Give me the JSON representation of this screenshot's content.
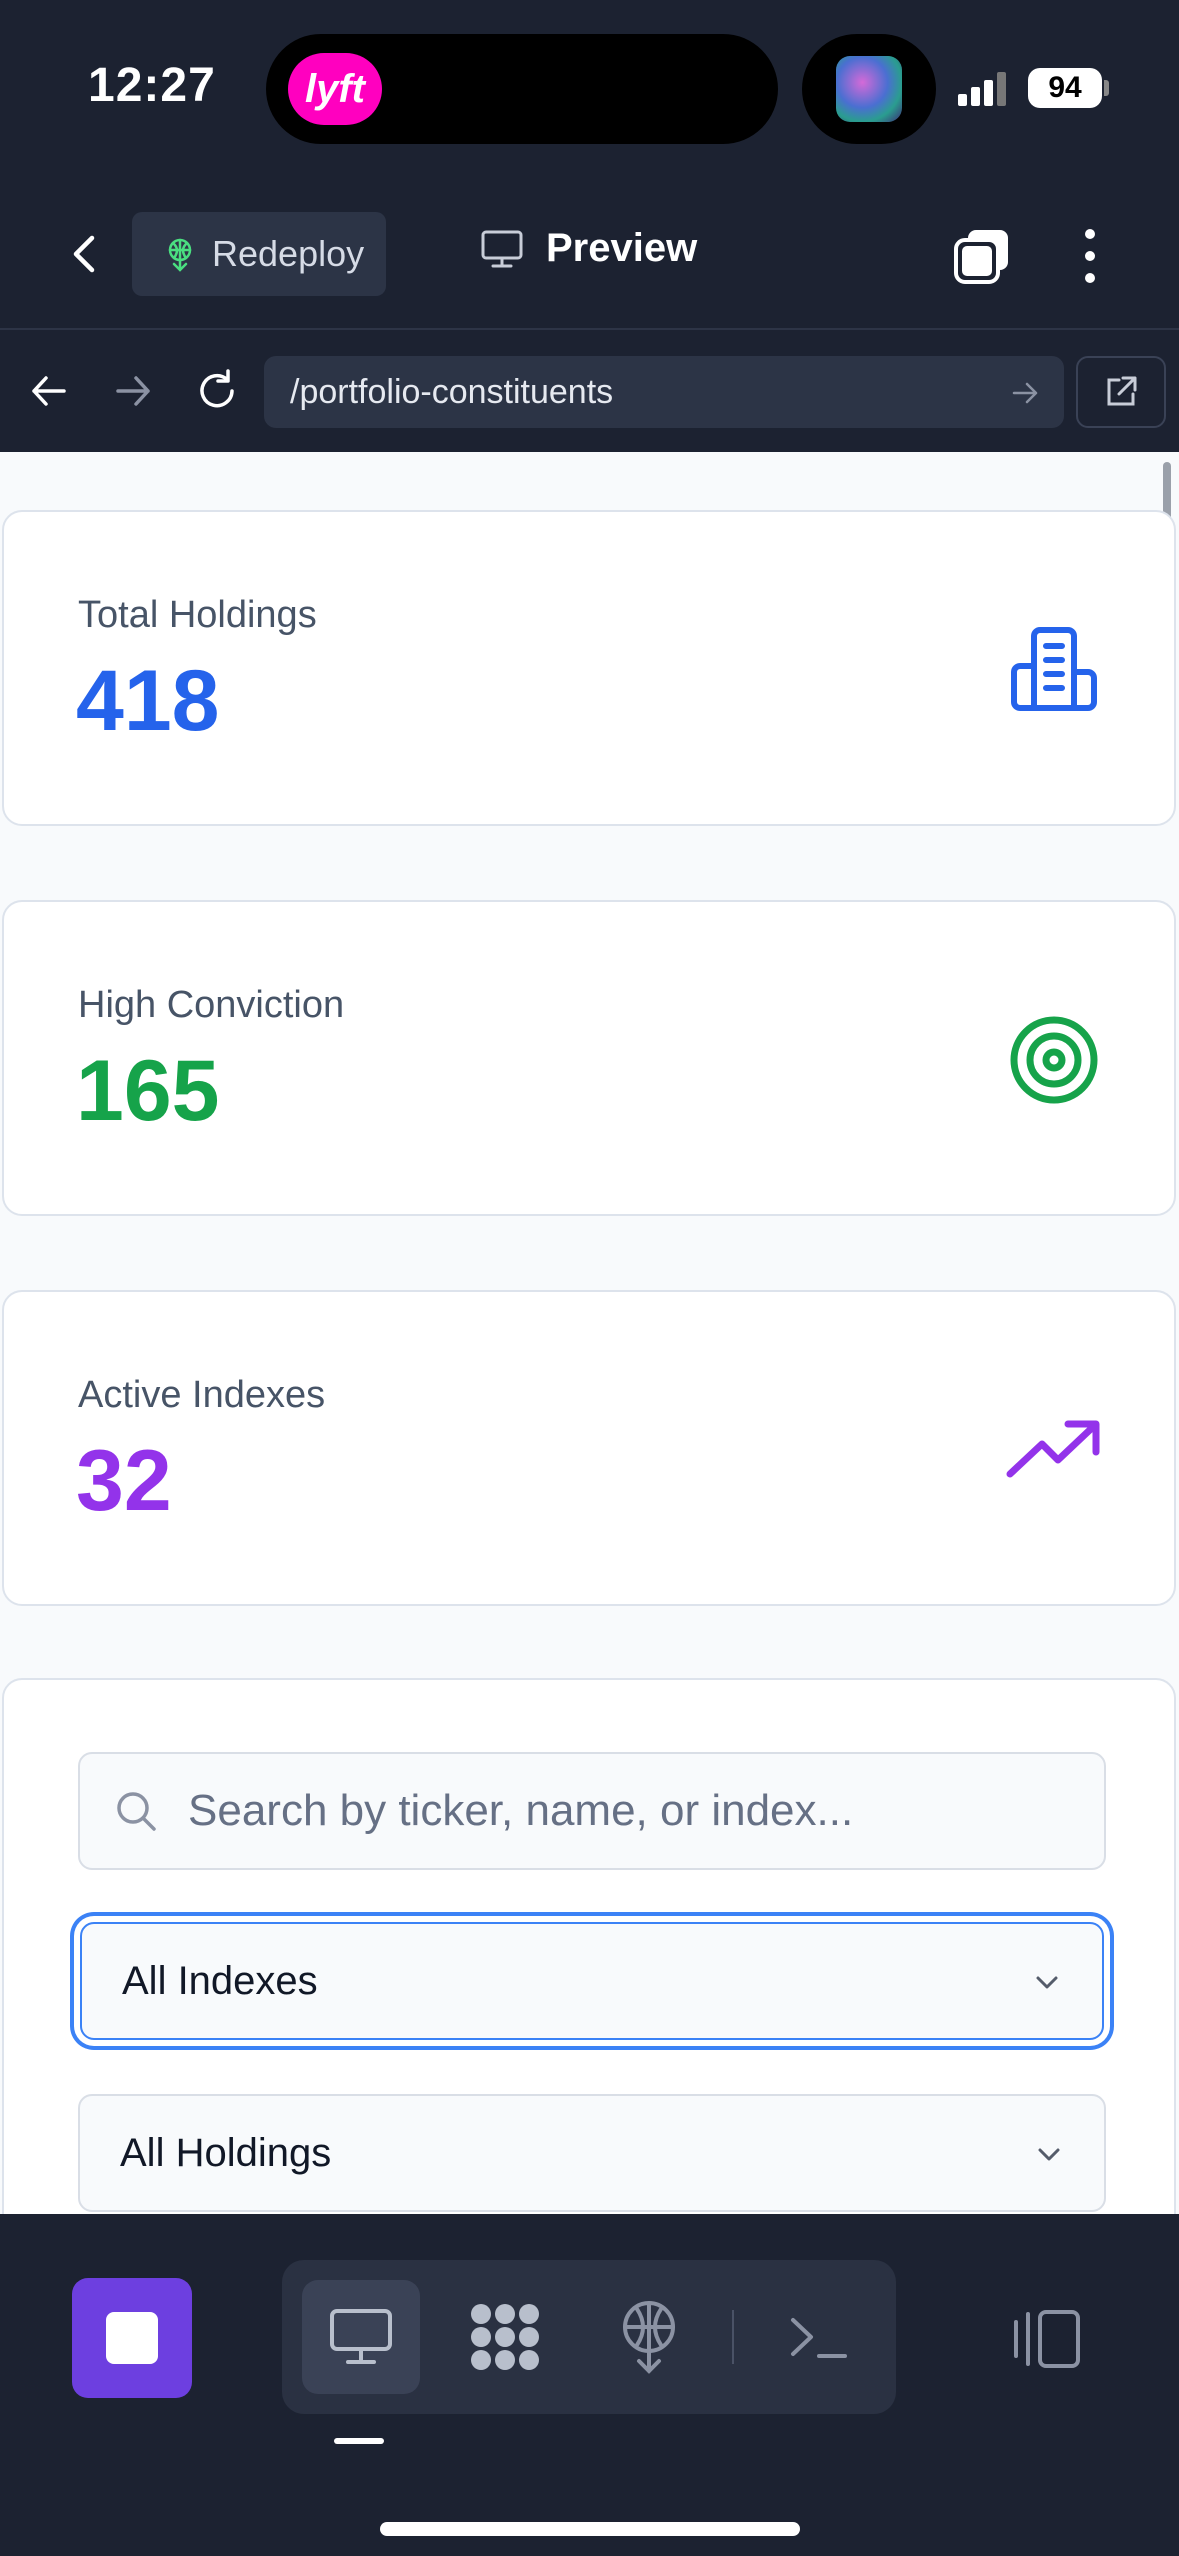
{
  "status": {
    "time": "12:27",
    "battery": "94",
    "live_activity_app": "lyft"
  },
  "header": {
    "redeploy_label": "Redeploy",
    "preview_label": "Preview"
  },
  "urlbar": {
    "url": "/portfolio-constituents"
  },
  "stats": [
    {
      "label": "Total Holdings",
      "value": "418",
      "color": "#2563eb",
      "icon": "building-icon"
    },
    {
      "label": "High Conviction",
      "value": "165",
      "color": "#16a34a",
      "icon": "target-icon"
    },
    {
      "label": "Active Indexes",
      "value": "32",
      "color": "#9333ea",
      "icon": "trending-up-icon"
    }
  ],
  "filters": {
    "search_placeholder": "Search by ticker, name, or index...",
    "index_select": "All Indexes",
    "holdings_select": "All Holdings"
  },
  "toolbar": {
    "tools": [
      "desktop-icon",
      "apps-icon",
      "deploy-icon",
      "terminal-icon"
    ],
    "accent": "#6d3fe0"
  }
}
